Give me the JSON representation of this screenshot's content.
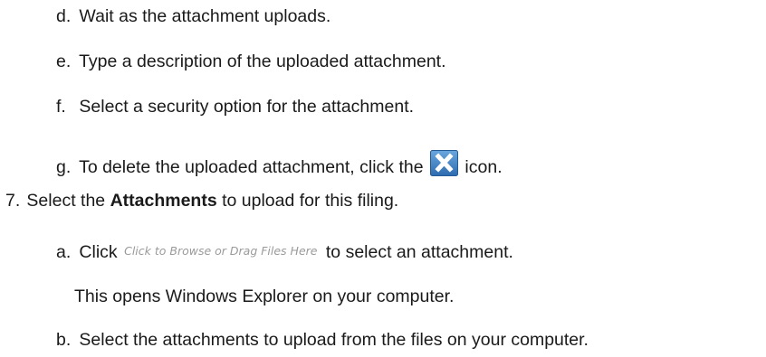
{
  "steps": {
    "d": {
      "marker": "d.",
      "text": "Wait as the attachment uploads."
    },
    "e": {
      "marker": "e.",
      "text": "Type a description of the uploaded attachment."
    },
    "f": {
      "marker": "f.",
      "text": "Select a security option for the attachment."
    },
    "g": {
      "marker": "g.",
      "text_before": "To delete the uploaded attachment, click the",
      "icon": "delete-x-icon",
      "text_after": "icon."
    },
    "step7": {
      "marker": "7.",
      "text_before": "Select the",
      "bold": "Attachments",
      "text_after": "to upload for this filing."
    },
    "a": {
      "marker": "a.",
      "text_before": "Click",
      "link": "Click to Browse or Drag Files Here",
      "text_after": "to select an attachment."
    },
    "a_note": {
      "text": "This opens Windows Explorer on your computer."
    },
    "b": {
      "marker": "b.",
      "text": "Select the attachments to upload from the files on your computer."
    }
  },
  "colors": {
    "text": "#1a1a1a",
    "icon_bg": "#3b7fc4",
    "link_text": "#9a9a9a"
  }
}
